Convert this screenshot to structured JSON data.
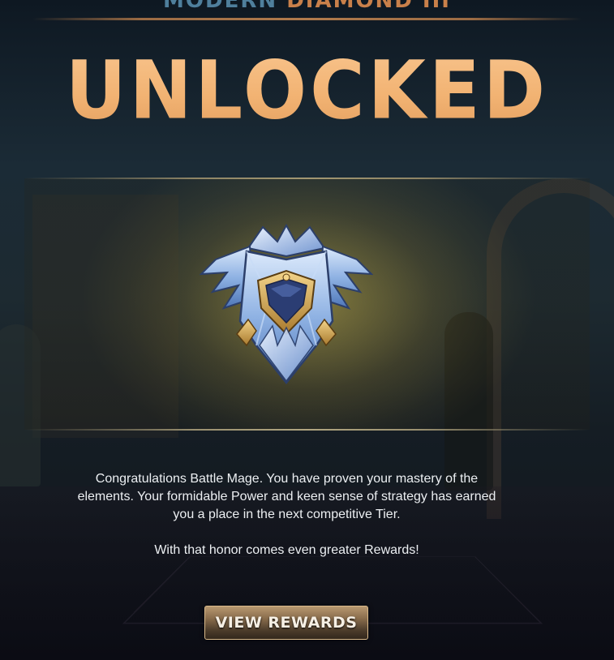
{
  "header": {
    "league_part1": "MODERN",
    "league_part2": "DIAMOND III"
  },
  "title": "UNLOCKED",
  "badge": {
    "icon": "diamond-league-shield-icon"
  },
  "message": {
    "paragraph1": "Congratulations Battle Mage. You have proven your mastery of the elements. Your formidable Power and keen sense of strategy has earned you a place in the next competitive Tier.",
    "paragraph2": "With that honor comes even greater Rewards!"
  },
  "actions": {
    "view_rewards_label": "VIEW REWARDS"
  },
  "colors": {
    "title": "#f2b373",
    "accent": "#c9804a",
    "league_blue": "#4f7f9c",
    "button_border": "#d9b98a"
  }
}
